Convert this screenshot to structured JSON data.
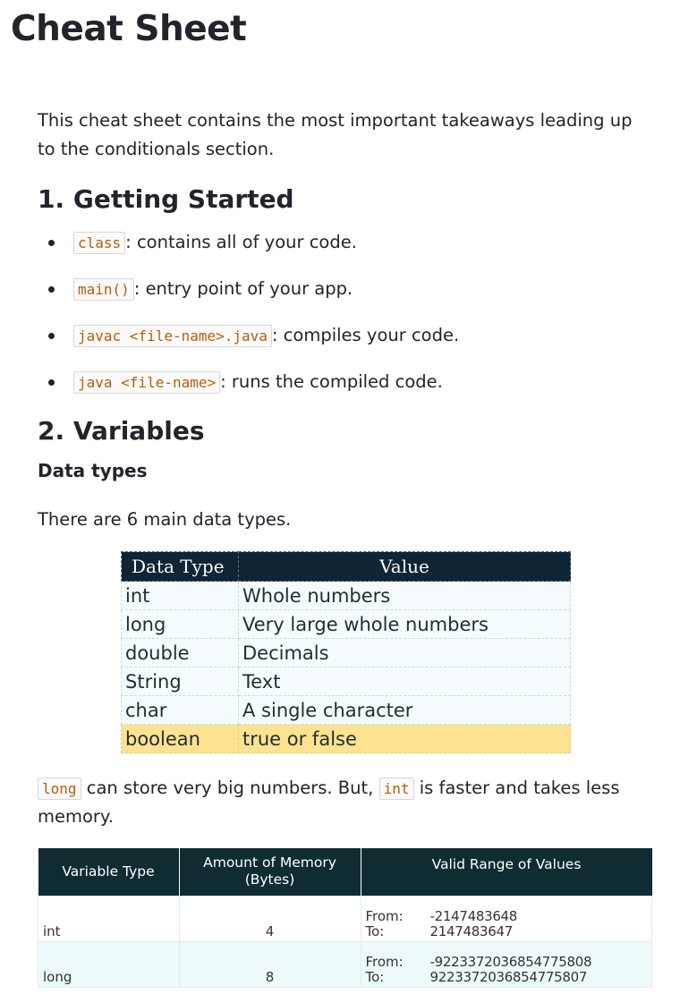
{
  "page": {
    "title": "Cheat Sheet"
  },
  "intro": "This cheat sheet contains the most important takeaways leading up to the conditionals section.",
  "section1": {
    "heading": "1. Getting Started",
    "items": [
      {
        "code": "class",
        "text": ": contains all of your code."
      },
      {
        "code": "main()",
        "text": ": entry point of your app."
      },
      {
        "code": "javac <file-name>.java",
        "text": ": compiles your code."
      },
      {
        "code": "java <file-name>",
        "text": ": runs the compiled code."
      }
    ]
  },
  "section2": {
    "heading": "2. Variables",
    "subheading": "Data types",
    "types_intro": "There are 6 main data types.",
    "data_types_table": {
      "headers": [
        "Data Type",
        "Value"
      ],
      "rows": [
        [
          "int",
          "Whole numbers"
        ],
        [
          "long",
          "Very large whole numbers"
        ],
        [
          "double",
          "Decimals"
        ],
        [
          "String",
          "Text"
        ],
        [
          "char",
          "A single character"
        ],
        [
          "boolean",
          "true or false"
        ]
      ],
      "highlight_color": "#fde28f",
      "header_color": "#0f2536"
    },
    "long_para": {
      "code1": "long",
      "text1": " can store very big numbers. But, ",
      "code2": "int",
      "text2": " is faster and takes less memory."
    },
    "variable_table": {
      "headers": [
        "Variable Type",
        "Amount of Memory (Bytes)",
        "Valid Range of Values"
      ],
      "from_label": "From:",
      "to_label": "To:",
      "rows": [
        {
          "type": "int",
          "memory": "4",
          "from": "-2147483648",
          "to": "2147483647"
        },
        {
          "type": "long",
          "memory": "8",
          "from": "-9223372036854775808",
          "to": "9223372036854775807"
        }
      ],
      "header_color": "#0f2c33"
    }
  }
}
